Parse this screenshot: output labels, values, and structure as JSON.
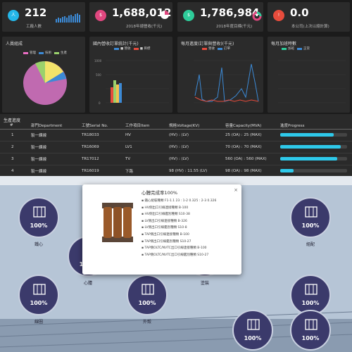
{
  "kpis": [
    {
      "value": "212",
      "label": "工廠人數",
      "icon": "person-icon",
      "color": "#24b6e8"
    },
    {
      "value": "1,688,012",
      "label": "2018年總營收(千元)",
      "icon": "money-icon",
      "color": "#e0477f"
    },
    {
      "value": "1,786,984",
      "label": "2018年度目標(千元)",
      "icon": "target-icon",
      "color": "#2ecc9a"
    },
    {
      "value": "0.0",
      "label": "本公司(上次以總計算)",
      "icon": "alert-icon",
      "color": "#e74c3c"
    }
  ],
  "panels": {
    "staff": {
      "title": "人員組成",
      "legend": [
        "管理",
        "技術",
        "生產",
        "其他"
      ],
      "legend_colors": [
        "#e96ec3",
        "#3c8ad6",
        "#9ad16c",
        "#f2c14e"
      ]
    },
    "bar": {
      "title": "國內營收訂單統計(千元)",
      "legend": [
        "■ 營收",
        "■ 目標"
      ],
      "legend_colors": [
        "#3c8ad6",
        "#e74c3c"
      ]
    },
    "line": {
      "title": "每月進度(訂單與營收)(千元)",
      "legend": [
        "營收",
        "訂單"
      ],
      "legend_colors": [
        "#e74c3c",
        "#3c8ad6"
      ]
    },
    "overtime": {
      "title": "每月加班時數",
      "legend": [
        "加班",
        "正常"
      ],
      "legend_colors": [
        "#2ecc9a",
        "#3c8ad6"
      ]
    }
  },
  "progress": {
    "title": "生產進度",
    "headers": [
      "#",
      "部門Department",
      "工號Serial No.",
      "工作項目Item",
      "規格Voltage(KV)",
      "容量Capacity(MVA)",
      "進度Progress"
    ],
    "rows": [
      {
        "no": "1",
        "dept": "製一課線",
        "serial": "TR18033",
        "item": "HV",
        "voltage": "(HV) : (LV)",
        "capacity": "25 (OA) : 25 (MAX)",
        "progress": 80
      },
      {
        "no": "2",
        "dept": "製一課線",
        "serial": "TR16069",
        "item": "LV1",
        "voltage": "(HV) : (LV)",
        "capacity": "70 (OA) : 70 (MAX)",
        "progress": 90
      },
      {
        "no": "3",
        "dept": "製一課線",
        "serial": "TR17012",
        "item": "TV",
        "voltage": "(HV) : (LV)",
        "capacity": "560 (OA) : 560 (MAX)",
        "progress": 85
      },
      {
        "no": "4",
        "dept": "製一課線",
        "serial": "TR16019",
        "item": "下路",
        "voltage": "98 (HV) : 11.55 (LV)",
        "capacity": "98 (OA) : 98 (MAX)",
        "progress": 20
      },
      {
        "no": "5",
        "dept": "製一課線",
        "serial": "TR16019",
        "item": "下路",
        "voltage": "98 (HV) : 11.55 (LV)",
        "capacity": "98 (OA) : 98 (MAX)",
        "progress": 30
      }
    ]
  },
  "flow": {
    "stages": [
      {
        "name": "鐵心",
        "pct": "100%",
        "icon": "core-icon"
      },
      {
        "name": "線圈",
        "pct": "100%",
        "icon": "coil-icon"
      },
      {
        "name": "心體",
        "pct": "100%",
        "icon": "body-icon"
      },
      {
        "name": "外殼",
        "pct": "100%",
        "icon": "tank-icon"
      },
      {
        "name": "塗裝",
        "pct": "100%",
        "icon": "paint-icon"
      },
      {
        "name": "組配",
        "pct": "100%",
        "icon": "assembly-icon"
      },
      {
        "name": "完成品",
        "pct": "100%",
        "icon": "finished-icon"
      },
      {
        "name": "現場組裝",
        "pct": "100%",
        "icon": "site-icon"
      },
      {
        "name": "運輸",
        "pct": "100%",
        "icon": "truck-icon"
      }
    ]
  },
  "modal": {
    "title": "心體完成率100%",
    "close": "×",
    "items": [
      "鐵心組裝種類 F1-1.1 23 : 1-2 0.325 : 2-3 0.326",
      "HV側出口引線連接種類 B-100",
      "HV側出口引線鑑別種類 S10-38",
      "LV側出口引線連接種類 B-326",
      "LV側出口引線鑑別種類 S10-8",
      "TAP側出口引線連接種類 B-100",
      "TAP側出口引線鑑別種類 S10-27",
      "TAP側OLTC/NVTC出口引線連接種類 B-100",
      "TAP側OLTC/NVTC出口引線鑑別種類 S10-27"
    ]
  }
}
